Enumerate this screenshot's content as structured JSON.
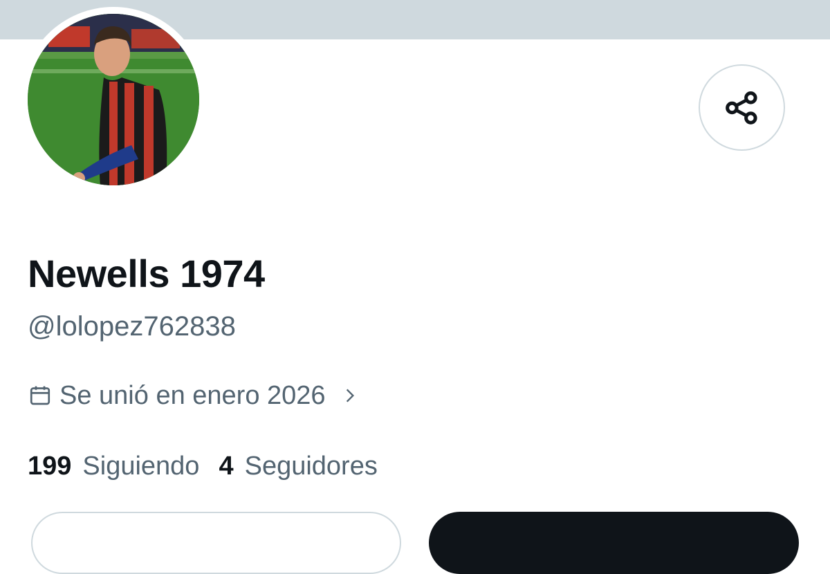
{
  "profile": {
    "display_name": "Newells 1974",
    "handle": "@lolopez762838",
    "joined": "Se unió en enero 2026",
    "avatar": "profile-photo"
  },
  "stats": {
    "following_count": "199",
    "following_label": "Siguiendo",
    "followers_count": "4",
    "followers_label": "Seguidores"
  },
  "icons": {
    "share": "share-icon",
    "calendar": "calendar-icon",
    "chevron": "chevron-right-icon"
  },
  "colors": {
    "banner": "#cfd9de",
    "text_primary": "#0f1419",
    "text_secondary": "#536471",
    "border": "#cfd9de"
  }
}
